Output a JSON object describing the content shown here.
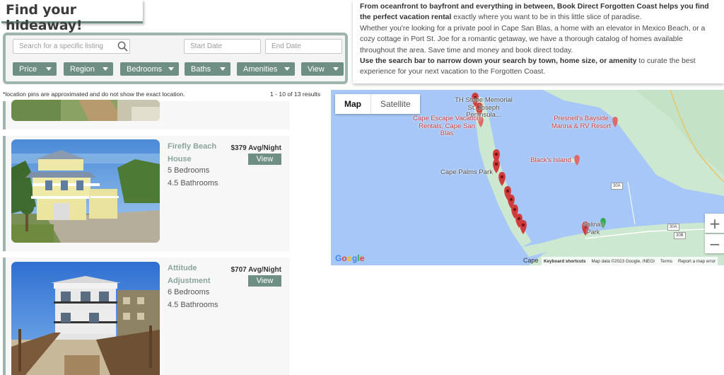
{
  "title": "Find your hideaway!",
  "search": {
    "listing_placeholder": "Search for a specific listing",
    "start_placeholder": "Start Date",
    "end_placeholder": "End Date"
  },
  "filters": [
    "Price",
    "Region",
    "Bedrooms",
    "Baths",
    "Amenities",
    "View"
  ],
  "intro": {
    "p1_bold": "From oceanfront to bayfront and everything in between, Book Direct Forgotten Coast helps you find the perfect vacation rental",
    "p1_rest": " exactly where you want to be in this little slice of paradise.",
    "p2": "Whether you're looking for a private pool in Cape San Blas, a home with an elevator in Mexico Beach, or a cozy cottage in Port St. Joe for a romantic getaway, we have a thorough catalog of homes available throughout the area. Save time and money and book direct today.",
    "p3_bold": "Use the search bar to narrow down your search by town, home size, or amenity",
    "p3_rest": " to curate the best experience for your next vacation to the Forgotten Coast."
  },
  "note": "*location pins are approximated and do not show the exact location.",
  "results_count": "1 - 10 of 13 results",
  "listings": [
    {
      "name": "Firefly Beach House",
      "price": "$379 Avg/Night",
      "view_label": "View",
      "bedrooms": "5 Bedrooms",
      "bathrooms": "4.5 Bathrooms"
    },
    {
      "name": "Attitude Adjustment",
      "price": "$707 Avg/Night",
      "view_label": "View",
      "bedrooms": "6 Bedrooms",
      "bathrooms": "4.5 Bathrooms"
    }
  ],
  "map": {
    "tab_map": "Map",
    "tab_satellite": "Satellite",
    "zoom_in": "+",
    "zoom_out": "−",
    "poi": {
      "memorial": "TH Stone Memorial St. Joseph Peninsula...",
      "cape_escape": "Cape Escape Vacation Rentals, Cape San Blas",
      "presnell": "Presnell's Bayside Marina & RV Resort",
      "blacks_island": "Black's Island",
      "cape_palms": "Cape Palms Park",
      "salinas": "Salinas Park",
      "cape": "Cape"
    },
    "roads": [
      "30A",
      "30A",
      "30B"
    ],
    "attribution": {
      "keyboard": "Keyboard shortcuts",
      "mapdata": "Map data ©2023 Google, INEGI",
      "terms": "Terms",
      "report": "Report a map error"
    },
    "google": "Google"
  },
  "colors": {
    "accent": "#6f8f85",
    "accent_light": "#9db5ad",
    "listing_name": "#8aa59c",
    "water": "#a6c7f7",
    "land": "#cde8d0",
    "pin": "#d13b3b"
  }
}
